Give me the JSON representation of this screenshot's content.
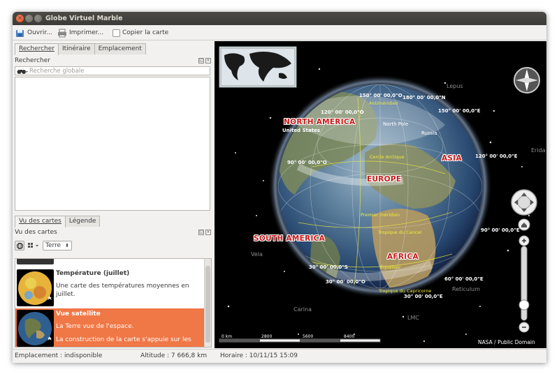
{
  "window": {
    "title": "Globe Virtuel Marble"
  },
  "toolbar": {
    "open": "Ouvrir...",
    "print": "Imprimer...",
    "copy": "Copier la carte"
  },
  "search_tabs": [
    "Rechercher",
    "Itinéraire",
    "Emplacement"
  ],
  "search": {
    "heading": "Rechercher",
    "placeholder": "Recherche globale"
  },
  "lower_tabs": [
    "Vu des cartes",
    "Légende"
  ],
  "map_view": {
    "heading": "Vu des cartes",
    "projection": "Terre",
    "items": [
      {
        "title": "Température (juillet)",
        "desc": [
          "Une carte des températures moyennes en juillet."
        ]
      },
      {
        "title": "Vue satellite",
        "desc": [
          "La Terre vue de l'espace.",
          "La construction de la carte s'appuie sur les"
        ],
        "selected": true
      }
    ]
  },
  "status": {
    "location": "Emplacement : indisponible",
    "altitude": "Altitude :  7 666,8 km",
    "time": "Horaire : 10/11/15 15:09"
  },
  "globe": {
    "continents": [
      "NORTH AMERICA",
      "EUROPE",
      "ASIA",
      "SOUTH AMERICA",
      "AFRICA"
    ],
    "places": [
      "United States",
      "North Pole",
      "Russia"
    ],
    "lines": [
      "Antiméridien",
      "Cercle Arctique",
      "Premier méridien",
      "Tropique du Cancer",
      "Équateur",
      "Tropique du Capricorne"
    ],
    "coords": [
      "150° 00' 00,0\"O",
      "180° 00' 00,0\"N",
      "150° 00' 00,0\"E",
      "120° 00' 00,0\"O",
      "120° 00' 00,0\"E",
      "90° 00' 00,0\"O",
      "90° 00' 00,0\"E",
      "30° 00' 00,0\"S",
      "30° 00' 00,0\"O",
      "60° 00' 00,0\"E",
      "30° 00' 00,0\"E"
    ],
    "stars": [
      "Lepus",
      "Erida",
      "Vela",
      "Carina",
      "Reticulum",
      "LMC"
    ]
  },
  "scale": {
    "ticks": [
      "0 km",
      "2800",
      "5600",
      "8400"
    ]
  },
  "attribution": "NASA / Public Domain",
  "colors": {
    "accent": "#f07746",
    "title_bar": "#3c3b37",
    "continent": "#c91a1a",
    "grid_label": "#f0ec3c"
  }
}
